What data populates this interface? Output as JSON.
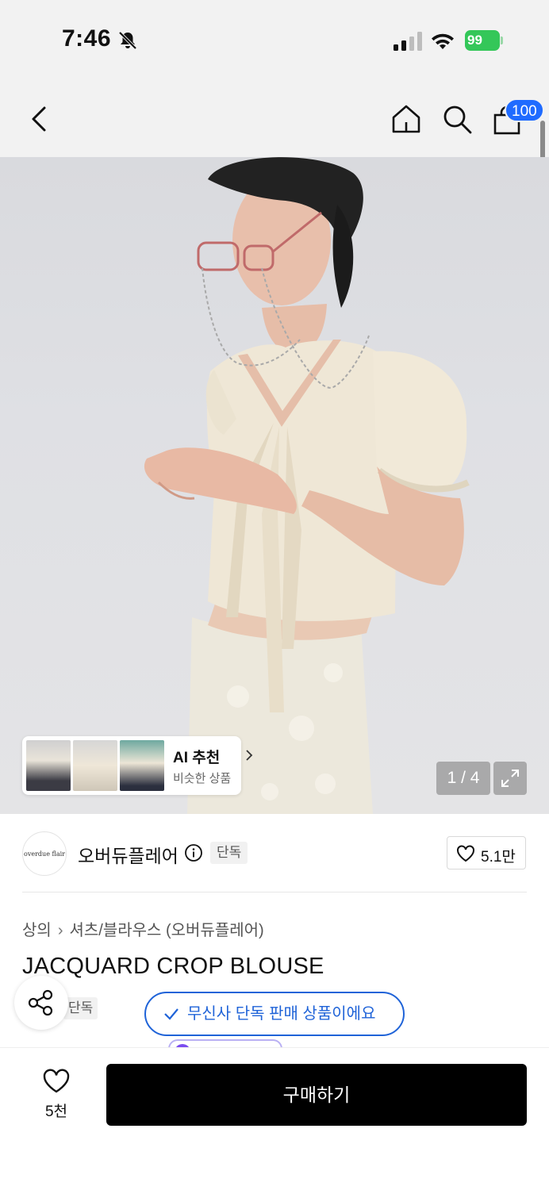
{
  "status_bar": {
    "time": "7:46",
    "battery": "99",
    "icons": [
      "bell-off-icon",
      "signal-icon",
      "wifi-icon",
      "battery-icon"
    ]
  },
  "nav": {
    "cart_count": "100",
    "icons": [
      "back-icon",
      "home-icon",
      "search-icon",
      "shopping-bag-icon"
    ]
  },
  "hero": {
    "page_indicator": "1 / 4",
    "ai_recommend": {
      "title": "AI 추천",
      "subtitle": "비슷한 상품"
    }
  },
  "brand": {
    "logo_text": "overdue flair",
    "name": "오버듀플레어",
    "tag": "단독",
    "likes": "5.1만"
  },
  "breadcrumb": {
    "category": "상의",
    "subcategory": "셔츠/블라우스 (오버듀플레어)"
  },
  "product": {
    "title": "JACQUARD CROP BLOUSE",
    "tag": "단독"
  },
  "toast": {
    "message": "무신사 단독 판매 상품이에요"
  },
  "bottom_bar": {
    "like_count": "5천",
    "buy_label": "구매하기"
  },
  "colors": {
    "accent_blue": "#1f63d8",
    "badge_blue": "#1f6bff",
    "battery_green": "#34c759",
    "buy_button": "#000000"
  }
}
